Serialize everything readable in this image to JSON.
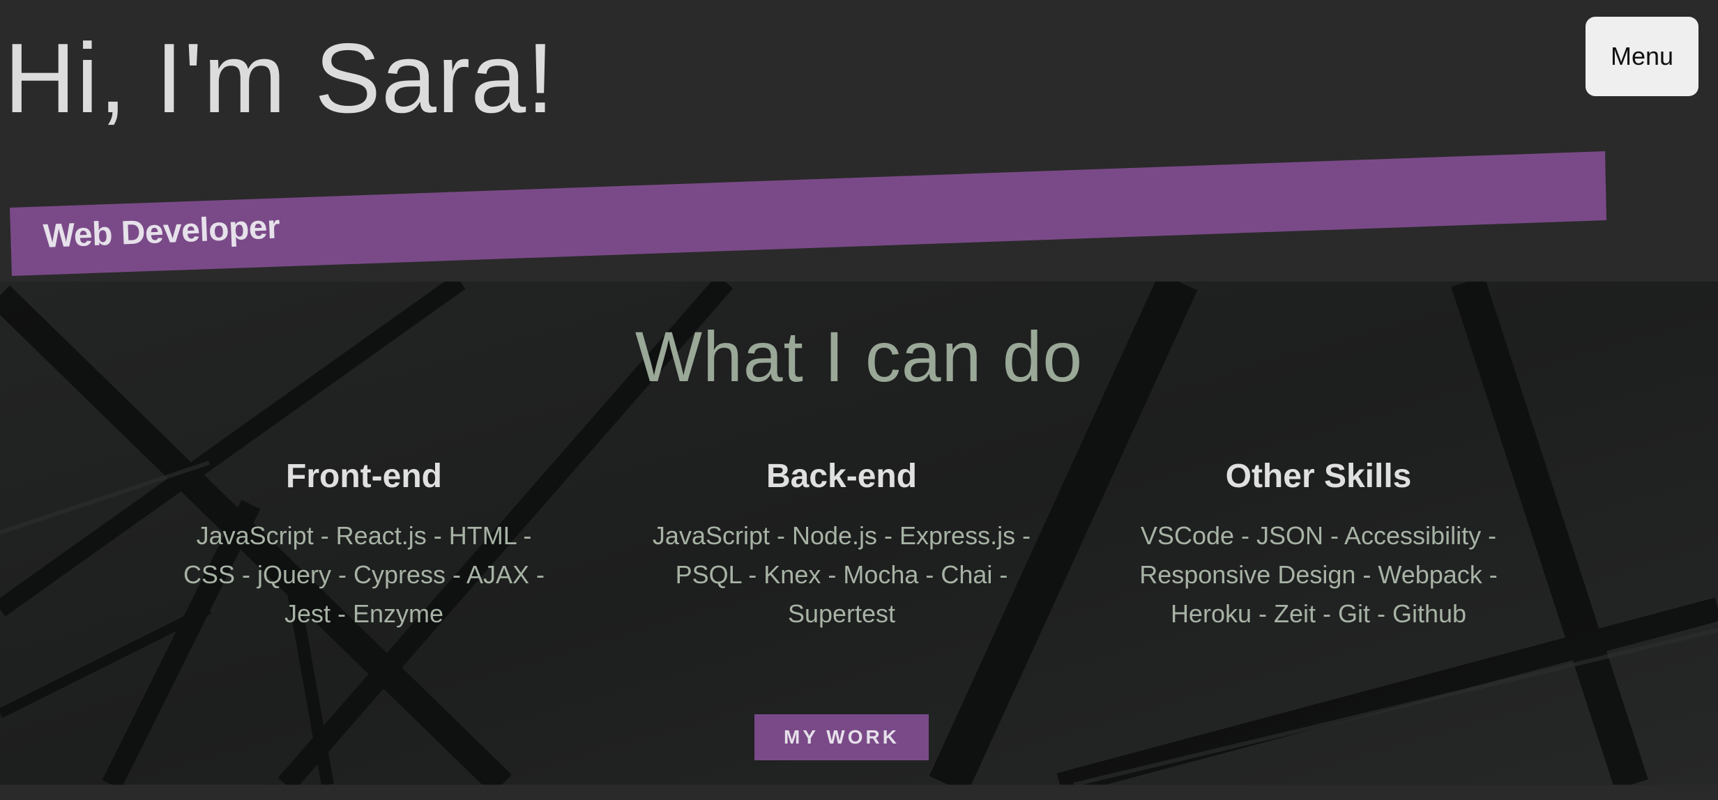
{
  "header": {
    "greeting": "Hi, I'm Sara!",
    "menu_label": "Menu",
    "role_banner": "Web Developer"
  },
  "skills": {
    "title": "What I can do",
    "columns": [
      {
        "heading": "Front-end",
        "lines": [
          "JavaScript - React.js - HTML -",
          "CSS - jQuery - Cypress - AJAX -",
          "Jest - Enzyme"
        ]
      },
      {
        "heading": "Back-end",
        "lines": [
          "JavaScript - Node.js - Express.js -",
          "PSQL - Knex - Mocha - Chai -",
          "Supertest"
        ]
      },
      {
        "heading": "Other Skills",
        "lines": [
          "VSCode - JSON - Accessibility -",
          "Responsive Design - Webpack -",
          "Heroku - Zeit - Git - Github"
        ]
      }
    ],
    "work_button": "MY WORK"
  },
  "colors": {
    "background": "#2a2a2a",
    "accent_purple": "#7a4a88",
    "heading_text": "#dcdcdc",
    "section_title": "#9aa898"
  }
}
